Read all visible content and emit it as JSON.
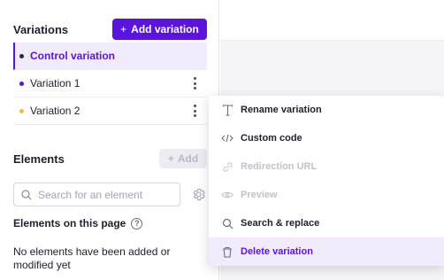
{
  "variations": {
    "title": "Variations",
    "add_button_label": "Add variation",
    "items": [
      {
        "label": "Control variation",
        "dot_color": "#2a2a3a",
        "selected": true
      },
      {
        "label": "Variation 1",
        "dot_color": "#5b14d9"
      },
      {
        "label": "Variation 2",
        "dot_color": "#e6c04a"
      }
    ]
  },
  "elements": {
    "title": "Elements",
    "add_button_label": "Add",
    "search_placeholder": "Search for an element",
    "page_title": "Elements on this page",
    "help_glyph": "?",
    "empty_text": "No elements have been added or modified yet"
  },
  "context_menu": {
    "items": [
      {
        "label": "Rename variation",
        "icon": "text-icon"
      },
      {
        "label": "Custom code",
        "icon": "code-icon"
      },
      {
        "label": "Redirection URL",
        "icon": "link-icon",
        "disabled": true
      },
      {
        "label": "Preview",
        "icon": "eye-icon",
        "disabled": true
      },
      {
        "label": "Search & replace",
        "icon": "search-icon"
      },
      {
        "label": "Delete variation",
        "icon": "trash-icon",
        "highlighted": true
      }
    ]
  },
  "colors": {
    "accent": "#5b14d9",
    "accent_light": "#f1ebfd",
    "disabled_text": "#c2c2cc"
  }
}
